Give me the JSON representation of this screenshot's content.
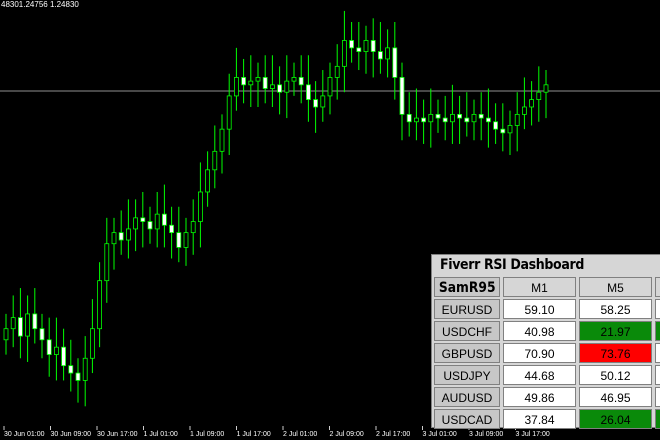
{
  "price_readout": "48301.24756 1.24830",
  "time_axis_labels": [
    "30 Jun 01:00",
    "30 Jun 09:00",
    "30 Jun 17:00",
    "1 Jul 01:00",
    "1 Jul 09:00",
    "1 Jul 17:00",
    "2 Jul 01:00",
    "2 Jul 09:00",
    "2 Jul 17:00",
    "3 Jul 01:00",
    "3 Jul 09:00",
    "3 Jul 17:00"
  ],
  "colors": {
    "background": "#000000",
    "candle": "#00ff00",
    "price_line": "#c0c0c0",
    "green_cell": "#0a8a0a",
    "red_cell": "#ff0000",
    "white_cell": "#ffffff"
  },
  "chart_data": {
    "type": "candlestick",
    "closes": [
      1.2452,
      1.2455,
      1.245,
      1.2456,
      1.2452,
      1.2449,
      1.2445,
      1.2447,
      1.2442,
      1.244,
      1.2438,
      1.2444,
      1.2452,
      1.2465,
      1.2475,
      1.2478,
      1.2476,
      1.2479,
      1.2482,
      1.2481,
      1.2479,
      1.2483,
      1.248,
      1.2478,
      1.2474,
      1.2478,
      1.2481,
      1.2489,
      1.2495,
      1.25,
      1.2506,
      1.2515,
      1.252,
      1.2518,
      1.2519,
      1.252,
      1.2517,
      1.2518,
      1.2516,
      1.2519,
      1.252,
      1.2518,
      1.2514,
      1.2512,
      1.2515,
      1.252,
      1.2523,
      1.253,
      1.2528,
      1.2527,
      1.253,
      1.2527,
      1.2525,
      1.2528,
      1.252,
      1.251,
      1.2508,
      1.2509,
      1.2508,
      1.251,
      1.2509,
      1.2508,
      1.251,
      1.2509,
      1.2508,
      1.251,
      1.2509,
      1.2508,
      1.2506,
      1.2505,
      1.2507,
      1.251,
      1.2512,
      1.2514,
      1.2516,
      1.2518
    ]
  },
  "dashboard": {
    "title": "Fiverr RSI Dashboard",
    "account_label": "SamR95",
    "timeframes": [
      "M1",
      "M5"
    ],
    "rows": [
      {
        "symbol": "EURUSD",
        "m1": "59.10",
        "m5": "58.25",
        "m5_color": "white",
        "extra_color": "white"
      },
      {
        "symbol": "USDCHF",
        "m1": "40.98",
        "m5": "21.97",
        "m5_color": "green",
        "extra_color": "green"
      },
      {
        "symbol": "GBPUSD",
        "m1": "70.90",
        "m5": "73.76",
        "m5_color": "red",
        "extra_color": "white"
      },
      {
        "symbol": "USDJPY",
        "m1": "44.68",
        "m5": "50.12",
        "m5_color": "white",
        "extra_color": "white"
      },
      {
        "symbol": "AUDUSD",
        "m1": "49.86",
        "m5": "46.95",
        "m5_color": "white",
        "extra_color": "white"
      },
      {
        "symbol": "USDCAD",
        "m1": "37.84",
        "m5": "26.04",
        "m5_color": "green",
        "extra_color": "green"
      }
    ]
  }
}
